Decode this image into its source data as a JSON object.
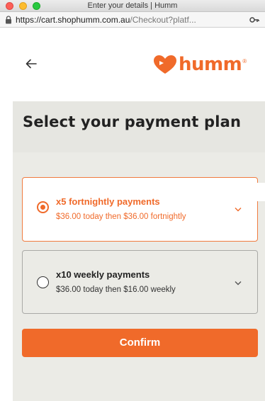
{
  "window": {
    "title": "Enter your details | Humm"
  },
  "urlbar": {
    "host": "https://cart.shophumm.com.au",
    "path": "/Checkout?platf..."
  },
  "header": {
    "back_icon": "arrow-left-icon",
    "logo_text": "humm",
    "logo_reg": "®"
  },
  "page": {
    "title": "Select your payment plan"
  },
  "plans": [
    {
      "title": "x5 fortnightly payments",
      "subtitle": "$36.00 today then $36.00 fortnightly",
      "selected": true
    },
    {
      "title": "x10 weekly payments",
      "subtitle": "$36.00 today then $16.00 weekly",
      "selected": false
    }
  ],
  "actions": {
    "confirm_label": "Confirm"
  },
  "colors": {
    "brand": "#f06a2a",
    "page_bg": "#ebebe6"
  }
}
